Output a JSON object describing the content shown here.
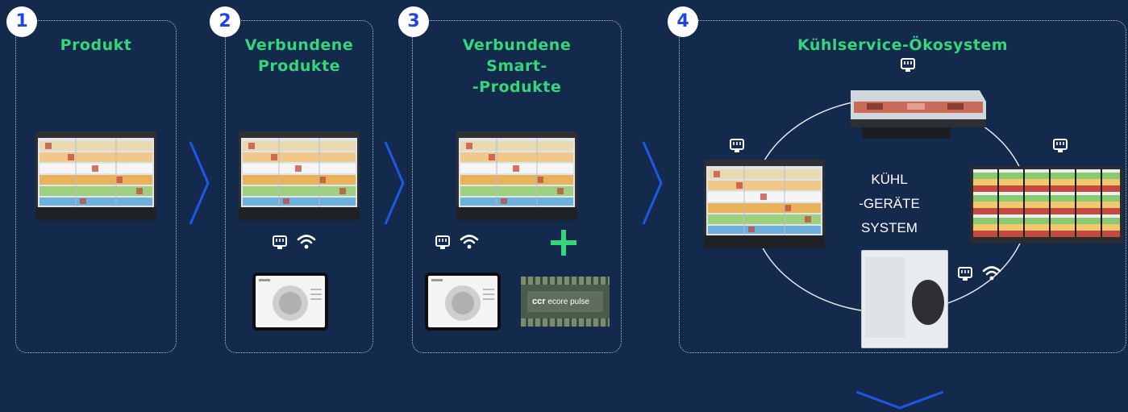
{
  "steps": [
    {
      "number": "1",
      "title": "Produkt"
    },
    {
      "number": "2",
      "title": "Verbundene\nProdukte"
    },
    {
      "number": "3",
      "title": "Verbundene\nSmart-\n-Produkte"
    },
    {
      "number": "4",
      "title": "Kühlservice-Ökosystem"
    }
  ],
  "ecosystem": {
    "center_line1": "KÜHL",
    "center_line2": "-GERÄTE",
    "center_line3": "SYSTEM"
  },
  "controller_label": "ecore pulse",
  "controller_brand": "ccr",
  "colors": {
    "background": "#142a4c",
    "title_green": "#35d67a",
    "badge_blue": "#1f46e0",
    "chevron_blue": "#1e56e6",
    "panel_border": "#b8c4d6"
  },
  "icons": [
    "ethernet-icon",
    "wifi-icon",
    "plus-icon",
    "chevron-right-icon",
    "chevron-down-icon"
  ]
}
